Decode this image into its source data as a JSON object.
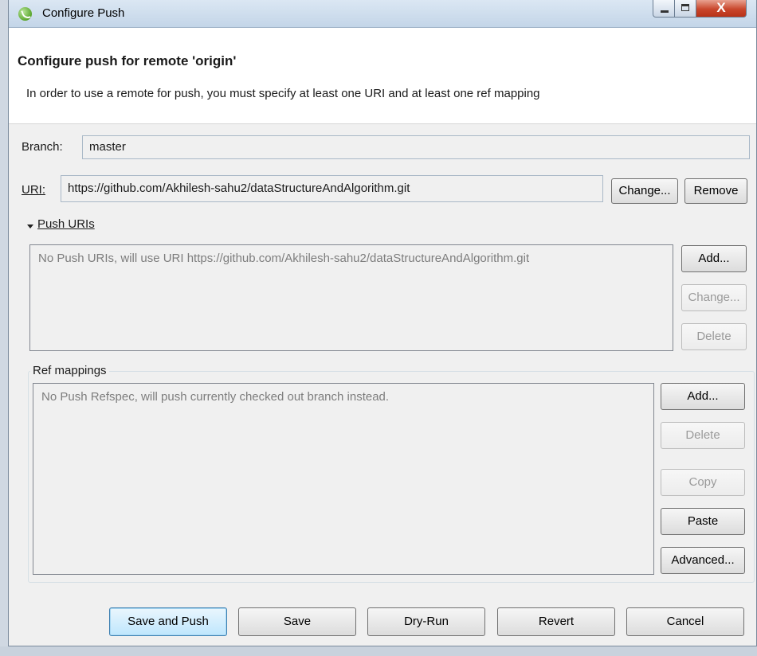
{
  "window": {
    "title": "Configure Push",
    "close_glyph": "X"
  },
  "header": {
    "title": "Configure push for remote 'origin'",
    "description": "In order to use a remote for push, you must specify at least one URI and at least one ref mapping"
  },
  "branch": {
    "label": "Branch:",
    "value": "master"
  },
  "uri": {
    "label": "URI:",
    "value": "https://github.com/Akhilesh-sahu2/dataStructureAndAlgorithm.git",
    "change_label": "Change...",
    "remove_label": "Remove"
  },
  "push_uris": {
    "section_label": "Push URIs",
    "empty_text": "No Push URIs, will use URI https://github.com/Akhilesh-sahu2/dataStructureAndAlgorithm.git",
    "add_label": "Add...",
    "change_label": "Change...",
    "delete_label": "Delete"
  },
  "ref_mappings": {
    "group_label": "Ref mappings",
    "empty_text": "No Push Refspec, will push currently checked out branch instead.",
    "add_label": "Add...",
    "delete_label": "Delete",
    "copy_label": "Copy",
    "paste_label": "Paste",
    "advanced_label": "Advanced..."
  },
  "footer": {
    "save_and_push_label": "Save and Push",
    "save_label": "Save",
    "dry_run_label": "Dry-Run",
    "revert_label": "Revert",
    "cancel_label": "Cancel"
  },
  "icons": {
    "app": "eclipse-spring-icon",
    "minimize": "minimize-icon",
    "maximize": "maximize-icon",
    "close": "close-icon",
    "expand": "caret-down-icon"
  },
  "colors": {
    "close_button": "#c9462c",
    "default_button_border": "#3c7fb1"
  }
}
